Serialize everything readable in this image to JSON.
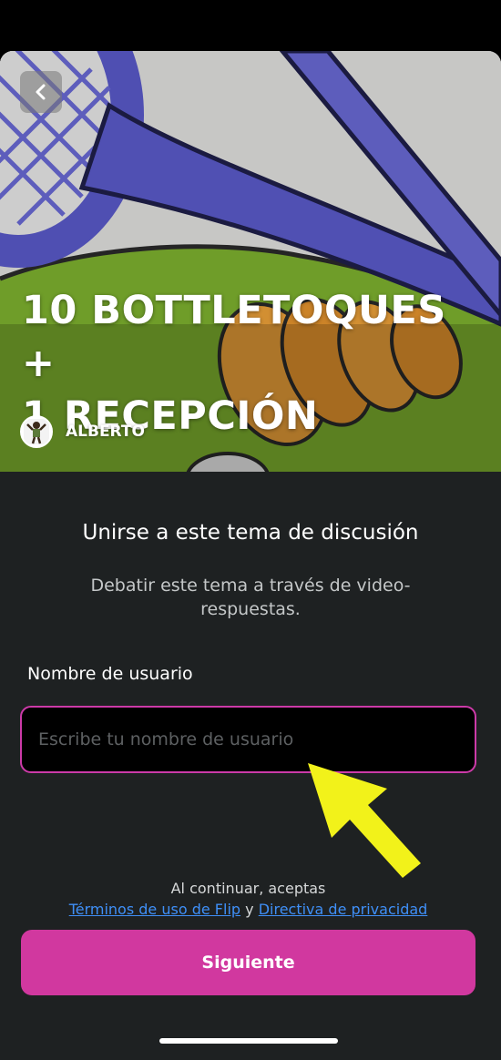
{
  "hero": {
    "title_line1": "10 BOTTLETOQUES +",
    "title_line2": "1 RECEPCIÓN",
    "author_name": "ALBERTO",
    "back_icon": "chevron-left-icon"
  },
  "join": {
    "title": "Unirse a este tema de discusión",
    "subtitle": "Debatir este tema a través de video-respuestas."
  },
  "form": {
    "username_label": "Nombre de usuario",
    "username_placeholder": "Escribe tu nombre de usuario",
    "username_value": ""
  },
  "terms": {
    "lead": "Al continuar, aceptas",
    "terms_link": "Términos de uso de Flip",
    "conjunction": "y",
    "privacy_link": "Directiva de privacidad"
  },
  "actions": {
    "next_label": "Siguiente"
  },
  "colors": {
    "accent": "#d1389f",
    "input_border": "#cc3aa8",
    "link": "#3f8ff7",
    "panel_bg": "#1e2122",
    "arrow": "#f2f21a"
  }
}
